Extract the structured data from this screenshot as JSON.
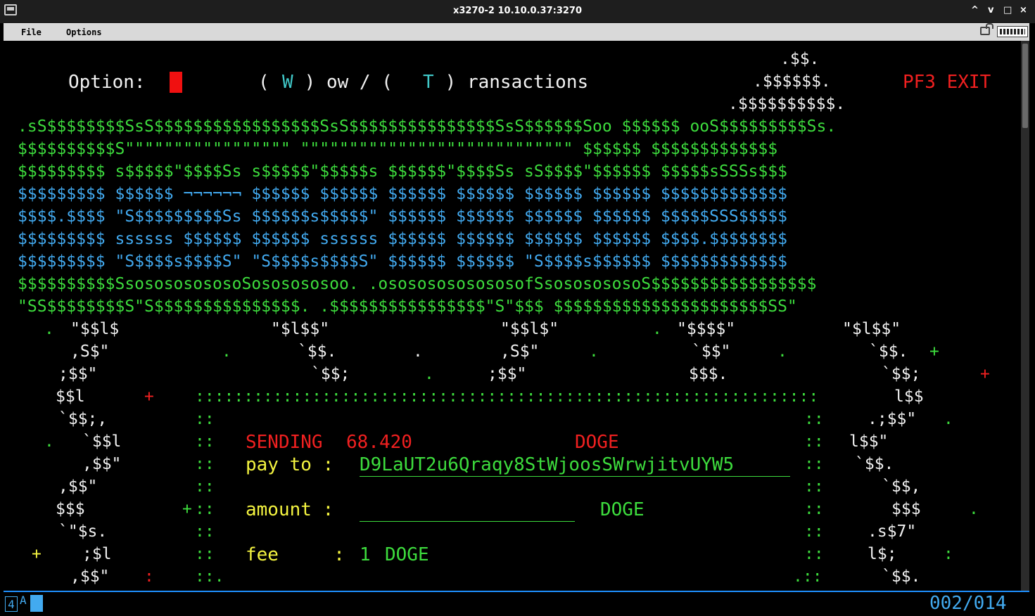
{
  "window": {
    "title": "x3270-2 10.10.0.37:3270",
    "minimize": "^",
    "maximize": "v",
    "restore": "□",
    "close": "×"
  },
  "menubar": {
    "file": "File",
    "options": "Options"
  },
  "screen": {
    "option_label": "Option:",
    "nav_prefix_w": "( ",
    "nav_w": "W",
    "nav_mid": " ) ow / ( ",
    "nav_t": "T",
    "nav_suffix": " ) ransactions",
    "pf3": "PF3 EXIT",
    "logo_top": [
      ".$$.",
      ".$$$$$$.",
      ".$$$$$$$$$$."
    ],
    "banner_rows": [
      ".sS$$$$$$$$SsS$$$$$$$$$$$$$$$$$SsS$$$$$$$$$$$$$$$SsS$$$$$$Soo $$$$$$ ooS$$$$$$$$$Ss.",
      "$$$$$$$$$$S\"\"\"\"\"\"\"\"\"\"\"\"\"\"\"\"\" \"\"\"\"\"\"\"\"\"\"\"\"\"\"\"\"\"\"\"\"\"\"\"\"\"\"\"\" $$$$$$ $$$$$$$$$$$$$",
      "$$$$$$$$$ s$$$$$\"$$$$Ss s$$$$$\"$$$$$s $$$$$$\"$$$$Ss sS$$$$\"$$$$$$ $$$$$sSSSs$$$",
      "$$$$$$$$$ $$$$$$ ¬¬¬¬¬¬ $$$$$$ $$$$$$ $$$$$$ $$$$$$ $$$$$$ $$$$$$ $$$$$$$$$$$$$",
      "$$$$.$$$$ \"S$$$$$$$$$Ss $$$$$$s$$$$$\" $$$$$$ $$$$$$ $$$$$$ $$$$$$ $$$$$SSS$$$$$",
      "$$$$$$$$$ ssssss $$$$$$ $$$$$$ ssssss $$$$$$ $$$$$$ $$$$$$ $$$$$$ $$$$.$$$$$$$$",
      "$$$$$$$$$ \"S$$$$s$$$$S\" \"S$$$$s$$$$S\" $$$$$$ $$$$$$ \"S$$$$s$$$$$$ $$$$$$$$$$$$$",
      "$$$$$$$$$$SsosososososoSososososoo. .osososososososofSsososososoS$$$$$$$$$$$$$$$$$",
      "\"SS$$$$$$$$S\"S$$$$$$$$$$$$$$$. .$$$$$$$$$$$$$$$$\"S\"$$$ $$$$$$$$$$$$$$$$$$$$$$SS\""
    ],
    "legs": [
      {
        "r": 0,
        "segs": [
          [
            ". ",
            "g"
          ],
          [
            "\"$$l$",
            "w"
          ],
          [
            "",
            "w"
          ]
        ]
      }
    ],
    "dialog": {
      "sending_label": "SENDING",
      "sending_amount": "68.420",
      "sending_currency": "DOGE",
      "pay_label": "pay to :",
      "pay_address": "D9LaUT2u6Qraqy8StWjoosSWrwjitvUYW5",
      "amount_label": "amount :",
      "amount_value": "",
      "amount_currency": "DOGE",
      "fee_label": "fee     :",
      "fee_value": "1",
      "fee_currency": "DOGE"
    }
  },
  "oia": {
    "indicator": "4",
    "mode": "A",
    "cursor_pos": "002/014"
  }
}
